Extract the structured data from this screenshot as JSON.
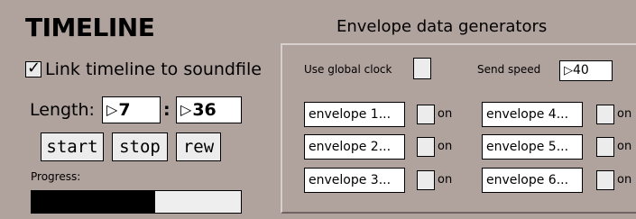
{
  "timeline": {
    "title": "TIMELINE",
    "link_label": "Link timeline to soundfile",
    "link_checked": true,
    "length_label": "Length:",
    "length_minutes": "7",
    "colon": ":",
    "length_seconds": "36",
    "start_label": "start",
    "stop_label": "stop",
    "rew_label": "rew",
    "progress_label": "Progress:",
    "progress_fraction": 0.59,
    "progress_color": "#000000"
  },
  "envelopes": {
    "title": "Envelope data generators",
    "global_clock_label": "Use global clock",
    "global_clock_checked": false,
    "send_speed_label": "Send speed",
    "send_speed_value": "40",
    "on_label": "on",
    "items": [
      {
        "label": "envelope 1...",
        "on": false
      },
      {
        "label": "envelope 2...",
        "on": false
      },
      {
        "label": "envelope 3...",
        "on": false
      },
      {
        "label": "envelope 4...",
        "on": false
      },
      {
        "label": "envelope 5...",
        "on": false
      },
      {
        "label": "envelope 6...",
        "on": false
      }
    ]
  },
  "colors": {
    "background": "#b0a29d",
    "field": "#ffffff",
    "button": "#ececec"
  }
}
